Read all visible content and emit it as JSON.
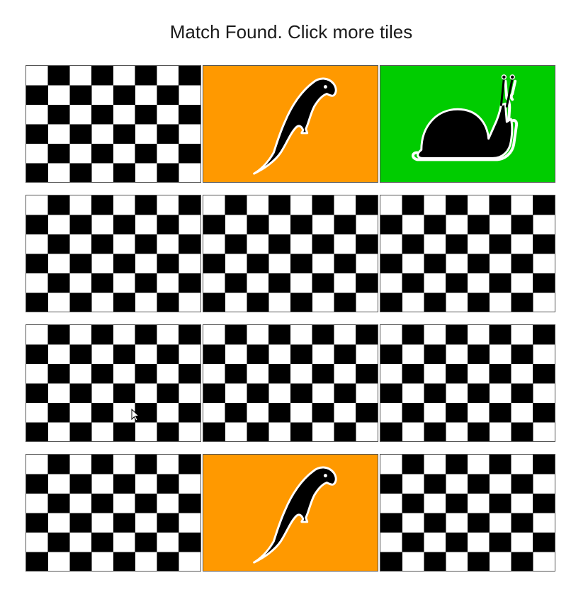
{
  "status_text": "Match Found. Click more tiles",
  "colors": {
    "parrot_tile": "#ff9900",
    "snail_tile": "#00cc00",
    "silhouette": "#000000",
    "outline": "#ffffff"
  },
  "tiles": [
    {
      "row": 1,
      "col": 1,
      "state": "hidden",
      "icon": null
    },
    {
      "row": 1,
      "col": 2,
      "state": "revealed",
      "icon": "parrot-icon"
    },
    {
      "row": 1,
      "col": 3,
      "state": "revealed",
      "icon": "snail-icon"
    },
    {
      "row": 2,
      "col": 1,
      "state": "hidden",
      "icon": null
    },
    {
      "row": 2,
      "col": 2,
      "state": "hidden",
      "icon": null
    },
    {
      "row": 2,
      "col": 3,
      "state": "hidden",
      "icon": null
    },
    {
      "row": 3,
      "col": 1,
      "state": "hidden",
      "icon": null
    },
    {
      "row": 3,
      "col": 2,
      "state": "hidden",
      "icon": null
    },
    {
      "row": 3,
      "col": 3,
      "state": "hidden",
      "icon": null
    },
    {
      "row": 4,
      "col": 1,
      "state": "hidden",
      "icon": null
    },
    {
      "row": 4,
      "col": 2,
      "state": "revealed",
      "icon": "parrot-icon"
    },
    {
      "row": 4,
      "col": 3,
      "state": "hidden",
      "icon": null
    }
  ]
}
